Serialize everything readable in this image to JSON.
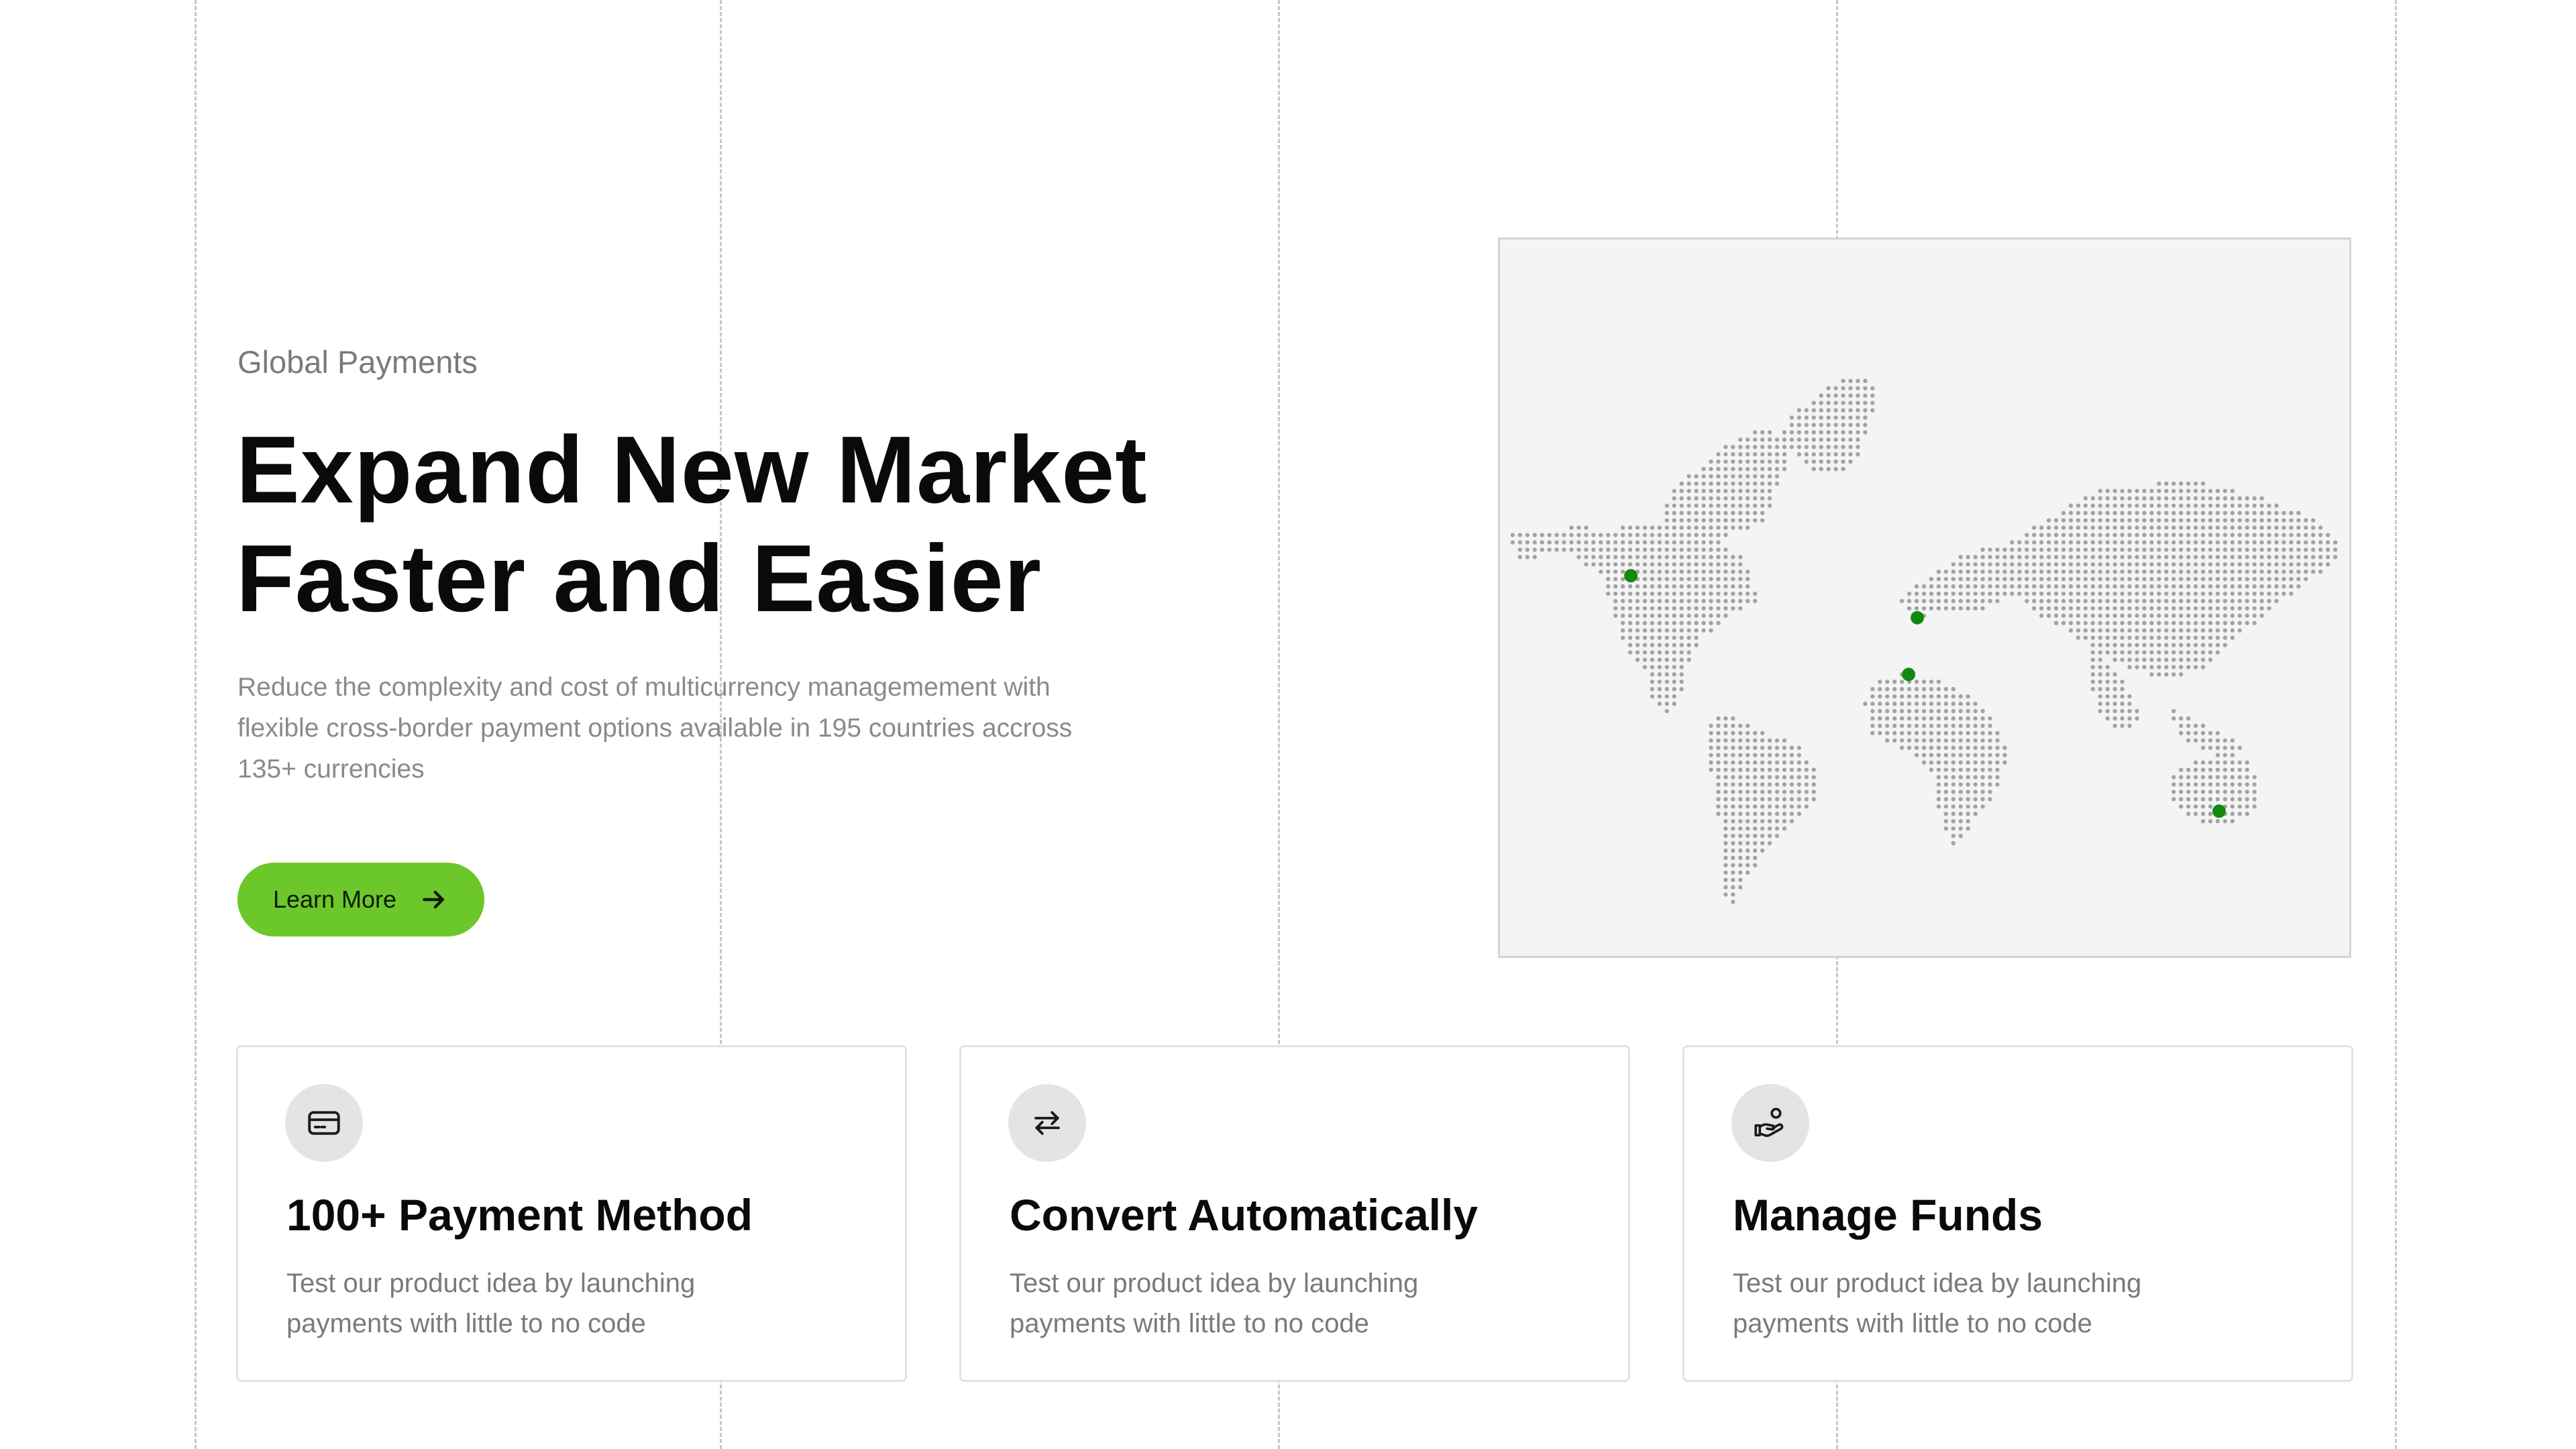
{
  "hero": {
    "eyebrow": "Global Payments",
    "headline_line1": "Expand New Market",
    "headline_line2": "Faster and Easier",
    "description": "Reduce the complexity and cost of multicurrency managemement with flexible cross-border payment options available in 195 countries accross 135+ currencies",
    "cta_label": "Learn More",
    "cta_icon": "arrow-right-icon"
  },
  "map": {
    "dot_color": "#a3a3a3",
    "marker_color": "#13880f",
    "marker_count": 4
  },
  "features": [
    {
      "icon": "credit-card-icon",
      "title": "100+ Payment Method",
      "text": "Test our product idea by launching payments with little to no code"
    },
    {
      "icon": "exchange-arrows-icon",
      "title": "Convert Automatically",
      "text": "Test our product idea by launching payments with little to no code"
    },
    {
      "icon": "hand-with-money-icon",
      "title": "Manage Funds",
      "text": "Test our product idea by launching payments with little to no code"
    }
  ],
  "colors": {
    "accent": "#6cc72a",
    "text_primary": "#0a0a0a",
    "text_secondary": "#7a7a7a",
    "icon_bg": "#e4e4e4"
  }
}
